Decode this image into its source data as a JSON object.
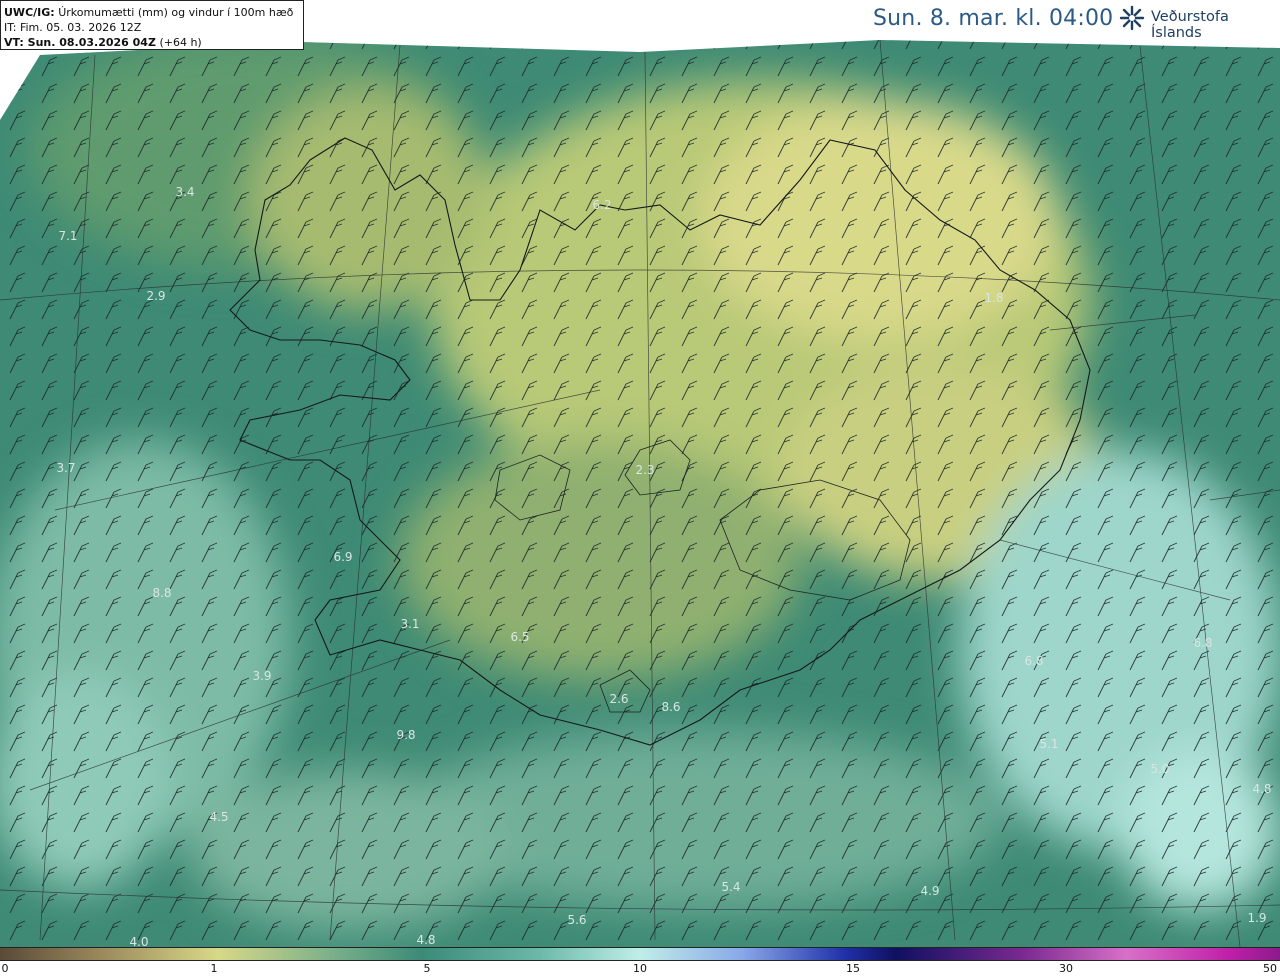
{
  "info_box": {
    "model_label": "UWC/IG:",
    "variable": "Úrkomumætti (mm) og vindur í 100m hæð",
    "initial_time": "IT: Fim. 05. 03. 2026 12Z",
    "valid_label": "VT: Sun. 08.03.2026 04Z",
    "valid_offset": "(+64 h)"
  },
  "title": "Sun. 8. mar. kl. 04:00",
  "logo_text": "Veðurstofa Íslands",
  "map_labels": [
    "3.4",
    "7.1",
    "2.9",
    "6.2",
    "1.8",
    "3.7",
    "2.3",
    "6.9",
    "8.8",
    "3.1",
    "6.5",
    "3.9",
    "2.6",
    "8.6",
    "6.8",
    "6.8",
    "5.1",
    "5.0",
    "4.8",
    "4.5",
    "9.8",
    "4.0",
    "5.6",
    "4.8",
    "5.4",
    "4.9",
    "1.9"
  ],
  "colorbar_ticks": [
    "0",
    "1",
    "5",
    "10",
    "15",
    "30",
    "50"
  ],
  "colors": {
    "sea_dark": "#2d7f6c",
    "land_dry": "#d8d98a",
    "precip_light": "#a6dcd2",
    "colorbar_purple": "#8b1a8b"
  }
}
